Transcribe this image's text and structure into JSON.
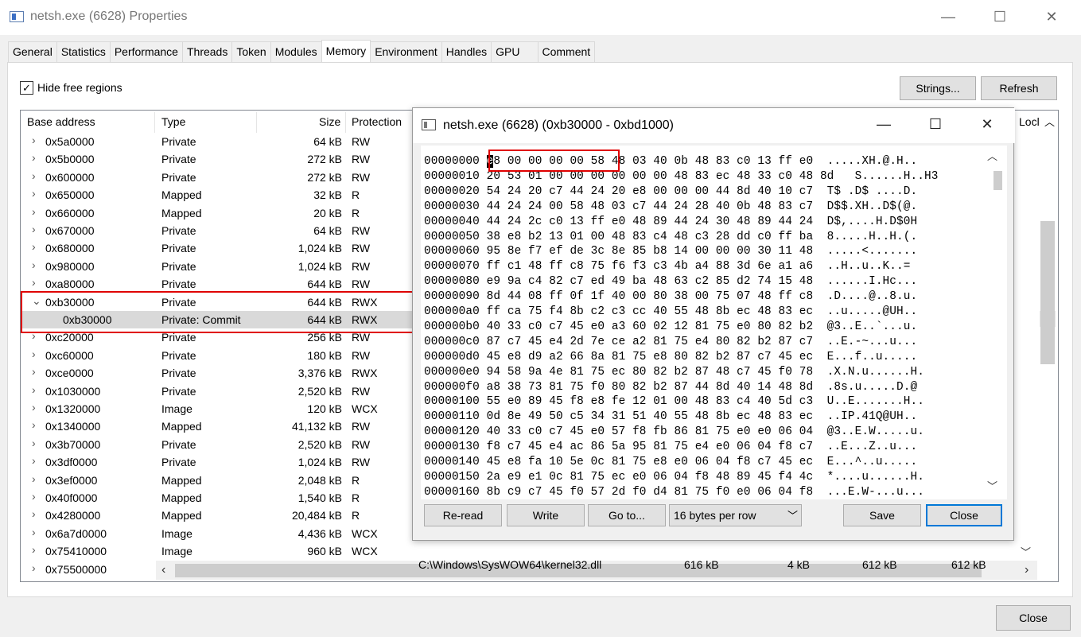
{
  "window": {
    "title": "netsh.exe (6628) Properties",
    "minimize": "—",
    "maximize": "☐",
    "close": "✕"
  },
  "tabs": [
    "General",
    "Statistics",
    "Performance",
    "Threads",
    "Token",
    "Modules",
    "Memory",
    "Environment",
    "Handles",
    "GPU",
    "Comment"
  ],
  "active_tab": "Memory",
  "memory": {
    "hide_free_label": "Hide free regions",
    "hide_free_checked": "✓",
    "strings_button": "Strings...",
    "refresh_button": "Refresh",
    "columns": {
      "base": "Base address",
      "type": "Type",
      "size": "Size",
      "protection": "Protection",
      "lock": "Locl"
    },
    "rows": [
      {
        "chev": "›",
        "addr": "0x5a0000",
        "type": "Private",
        "size": "64 kB",
        "prot": "RW"
      },
      {
        "chev": "›",
        "addr": "0x5b0000",
        "type": "Private",
        "size": "272 kB",
        "prot": "RW"
      },
      {
        "chev": "›",
        "addr": "0x600000",
        "type": "Private",
        "size": "272 kB",
        "prot": "RW"
      },
      {
        "chev": "›",
        "addr": "0x650000",
        "type": "Mapped",
        "size": "32 kB",
        "prot": "R"
      },
      {
        "chev": "›",
        "addr": "0x660000",
        "type": "Mapped",
        "size": "20 kB",
        "prot": "R"
      },
      {
        "chev": "›",
        "addr": "0x670000",
        "type": "Private",
        "size": "64 kB",
        "prot": "RW"
      },
      {
        "chev": "›",
        "addr": "0x680000",
        "type": "Private",
        "size": "1,024 kB",
        "prot": "RW"
      },
      {
        "chev": "›",
        "addr": "0x980000",
        "type": "Private",
        "size": "1,024 kB",
        "prot": "RW"
      },
      {
        "chev": "›",
        "addr": "0xa80000",
        "type": "Private",
        "size": "644 kB",
        "prot": "RW"
      },
      {
        "chev": "⌄",
        "addr": "0xb30000",
        "type": "Private",
        "size": "644 kB",
        "prot": "RWX"
      },
      {
        "chev": "",
        "addr": "0xb30000",
        "type": "Private: Commit",
        "size": "644 kB",
        "prot": "RWX",
        "child": true
      },
      {
        "chev": "›",
        "addr": "0xc20000",
        "type": "Private",
        "size": "256 kB",
        "prot": "RW"
      },
      {
        "chev": "›",
        "addr": "0xc60000",
        "type": "Private",
        "size": "180 kB",
        "prot": "RW"
      },
      {
        "chev": "›",
        "addr": "0xce0000",
        "type": "Private",
        "size": "3,376 kB",
        "prot": "RWX"
      },
      {
        "chev": "›",
        "addr": "0x1030000",
        "type": "Private",
        "size": "2,520 kB",
        "prot": "RW"
      },
      {
        "chev": "›",
        "addr": "0x1320000",
        "type": "Image",
        "size": "120 kB",
        "prot": "WCX"
      },
      {
        "chev": "›",
        "addr": "0x1340000",
        "type": "Mapped",
        "size": "41,132 kB",
        "prot": "RW"
      },
      {
        "chev": "›",
        "addr": "0x3b70000",
        "type": "Private",
        "size": "2,520 kB",
        "prot": "RW"
      },
      {
        "chev": "›",
        "addr": "0x3df0000",
        "type": "Private",
        "size": "1,024 kB",
        "prot": "RW"
      },
      {
        "chev": "›",
        "addr": "0x3ef0000",
        "type": "Mapped",
        "size": "2,048 kB",
        "prot": "R"
      },
      {
        "chev": "›",
        "addr": "0x40f0000",
        "type": "Mapped",
        "size": "1,540 kB",
        "prot": "R"
      },
      {
        "chev": "›",
        "addr": "0x4280000",
        "type": "Mapped",
        "size": "20,484 kB",
        "prot": "R"
      },
      {
        "chev": "›",
        "addr": "0x6a7d0000",
        "type": "Image",
        "size": "4,436 kB",
        "prot": "WCX"
      },
      {
        "chev": "›",
        "addr": "0x75410000",
        "type": "Image",
        "size": "960 kB",
        "prot": "WCX"
      },
      {
        "chev": "›",
        "addr": "0x75500000",
        "type": "",
        "size": "",
        "prot": ""
      }
    ],
    "extra_row": {
      "path": "C:\\Windows\\SysWOW64\\kernel32.dll",
      "c1": "616 kB",
      "c2": "4 kB",
      "c3": "612 kB",
      "c4": "612 kB"
    },
    "close_button": "Close"
  },
  "hex_dialog": {
    "title": "netsh.exe (6628) (0xb30000 - 0xbd1000)",
    "minimize": "—",
    "maximize": "☐",
    "close": "✕",
    "cursor_char": "e",
    "lines": [
      "00000000 e8 00 00 00 00 58 48 03 40 0b 48 83 c0 13 ff e0  .....XH.@.H..",
      "00000010 20 53 01 00 00 00 00 00 00 48 83 ec 48 33 c0 48 8d   S......H..H3",
      "00000020 54 24 20 c7 44 24 20 e8 00 00 00 44 8d 40 10 c7  T$ .D$ ....D.",
      "00000030 44 24 24 00 58 48 03 c7 44 24 28 40 0b 48 83 c7  D$$.XH..D$(@.",
      "00000040 44 24 2c c0 13 ff e0 48 89 44 24 30 48 89 44 24  D$,....H.D$0H",
      "00000050 38 e8 b2 13 01 00 48 83 c4 48 c3 28 dd c0 ff ba  8.....H..H.(.",
      "00000060 95 8e f7 ef de 3c 8e 85 b8 14 00 00 00 30 11 48  .....<.......",
      "00000070 ff c1 48 ff c8 75 f6 f3 c3 4b a4 88 3d 6e a1 a6  ..H..u..K..=",
      "00000080 e9 9a c4 82 c7 ed 49 ba 48 63 c2 85 d2 74 15 48  ......I.Hc...",
      "00000090 8d 44 08 ff 0f 1f 40 00 80 38 00 75 07 48 ff c8  .D....@..8.u.",
      "000000a0 ff ca 75 f4 8b c2 c3 cc 40 55 48 8b ec 48 83 ec  ..u.....@UH..",
      "000000b0 40 33 c0 c7 45 e0 a3 60 02 12 81 75 e0 80 82 b2  @3..E..`...u.",
      "000000c0 87 c7 45 e4 2d 7e ce a2 81 75 e4 80 82 b2 87 c7  ..E.-~...u...",
      "000000d0 45 e8 d9 a2 66 8a 81 75 e8 80 82 b2 87 c7 45 ec  E...f..u.....",
      "000000e0 94 58 9a 4e 81 75 ec 80 82 b2 87 48 c7 45 f0 78  .X.N.u......H.",
      "000000f0 a8 38 73 81 75 f0 80 82 b2 87 44 8d 40 14 48 8d  .8s.u.....D.@",
      "00000100 55 e0 89 45 f8 e8 fe 12 01 00 48 83 c4 40 5d c3  U..E.......H..",
      "00000110 0d 8e 49 50 c5 34 31 51 40 55 48 8b ec 48 83 ec  ..IP.41Q@UH..",
      "00000120 40 33 c0 c7 45 e0 57 f8 fb 86 81 75 e0 e0 06 04  @3..E.W.....u.",
      "00000130 f8 c7 45 e4 ac 86 5a 95 81 75 e4 e0 06 04 f8 c7  ..E...Z..u...",
      "00000140 45 e8 fa 10 5e 0c 81 75 e8 e0 06 04 f8 c7 45 ec  E...^..u.....",
      "00000150 2a e9 e1 0c 81 75 ec e0 06 04 f8 48 89 45 f4 4c  *....u......H.",
      "00000160 8b c9 c7 45 f0 57 2d f0 d4 81 75 f0 e0 06 04 f8  ...E.W-...u..."
    ],
    "buttons": {
      "reread": "Re-read",
      "write": "Write",
      "goto": "Go to...",
      "bytes_per_row": "16 bytes per row",
      "save": "Save",
      "close": "Close"
    }
  }
}
